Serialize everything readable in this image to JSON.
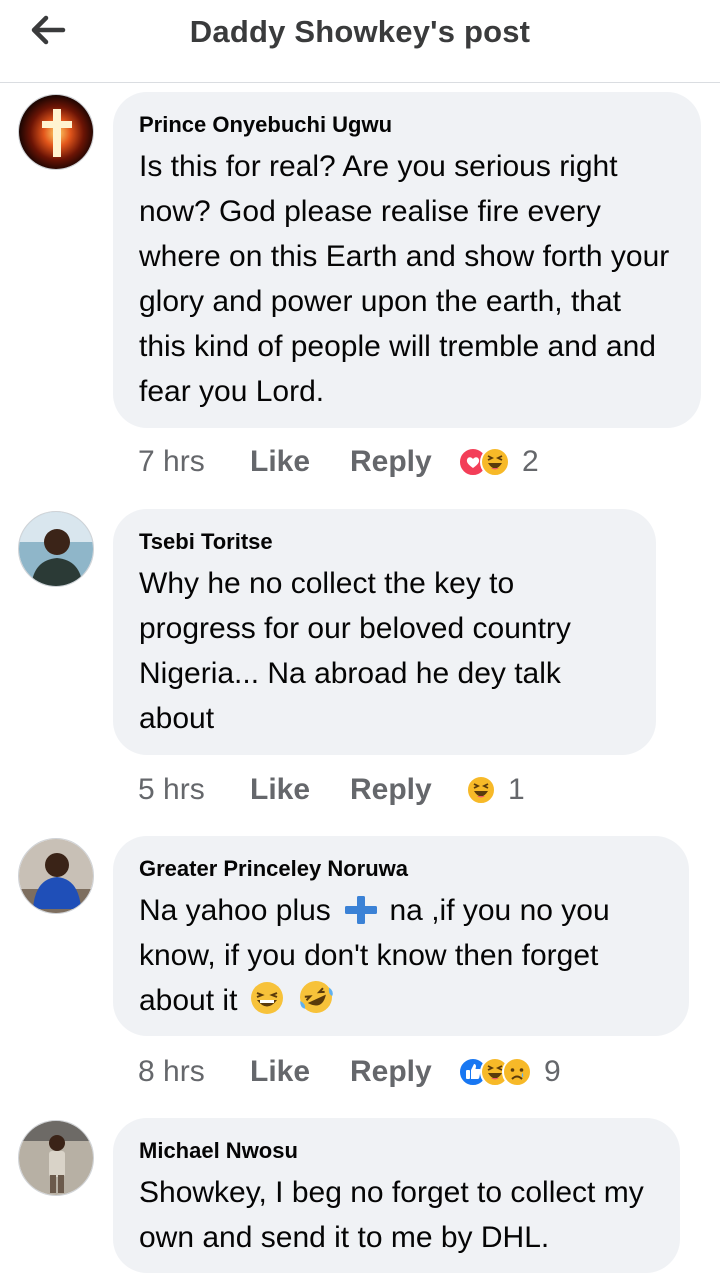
{
  "header": {
    "title": "Daddy Showkey's post",
    "back_icon": "arrow-left-icon"
  },
  "comments": [
    {
      "author": "Prince Onyebuchi Ugwu",
      "text": "Is this for real? Are you serious right now? God please realise fire every where on this Earth and show forth your glory and power upon the earth, that this kind of people will tremble and and fear you Lord.",
      "time": "7 hrs",
      "like": "Like",
      "reply": "Reply",
      "reactions": [
        "love-reaction-icon",
        "haha-reaction-icon"
      ],
      "reaction_count": "2"
    },
    {
      "author": "Tsebi Toritse",
      "text": "Why he no collect the key to progress for our beloved country Nigeria... Na abroad he dey talk about",
      "time": "5 hrs",
      "like": "Like",
      "reply": "Reply",
      "reactions": [
        "haha-reaction-icon"
      ],
      "reaction_count": "1"
    },
    {
      "author": "Greater Princeley Noruwa",
      "text_part1": "Na yahoo plus",
      "text_part2": "na ,if you no you know, if you don't know then forget about it",
      "time": "8 hrs",
      "like": "Like",
      "reply": "Reply",
      "reactions": [
        "like-reaction-icon",
        "haha-reaction-icon",
        "sad-reaction-icon"
      ],
      "reaction_count": "9"
    },
    {
      "author": "Michael Nwosu",
      "text": "Showkey, I beg no forget to collect my own and send it to me by DHL.",
      "time": "",
      "like": "",
      "reply": ""
    }
  ],
  "colors": {
    "bubble": "#f0f2f5",
    "meta": "#65676b",
    "like_blue": "#1877f2",
    "love_red": "#f33e58",
    "haha_yellow": "#f7b928"
  }
}
